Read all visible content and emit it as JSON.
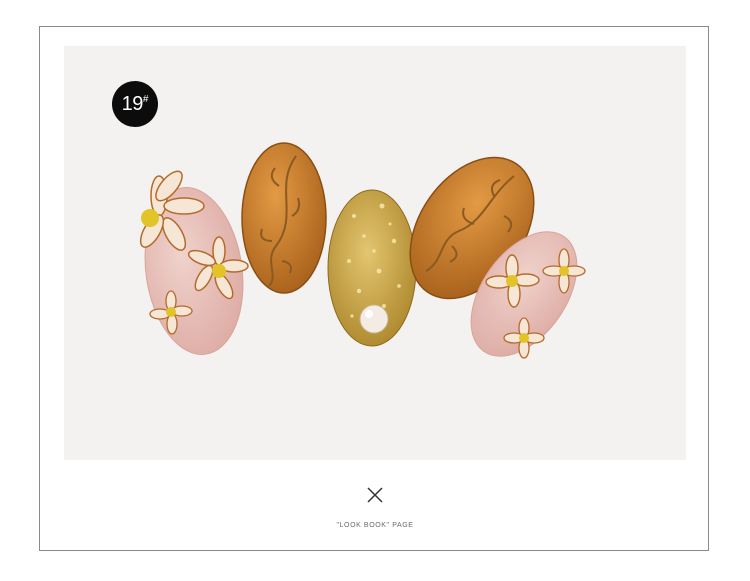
{
  "badge": {
    "number": "19",
    "mark": "#"
  },
  "caption": "\"LOOK BOOK\" PAGE",
  "icons": {
    "close": "close-icon"
  },
  "colors": {
    "frame": "#8a8a8a",
    "photo_bg": "#f3f2f1",
    "badge_bg": "#0c0c0c",
    "pink_nail": "#e8c3bd",
    "amber_nail": "#c97a28",
    "gold_nail": "#c9a443"
  }
}
